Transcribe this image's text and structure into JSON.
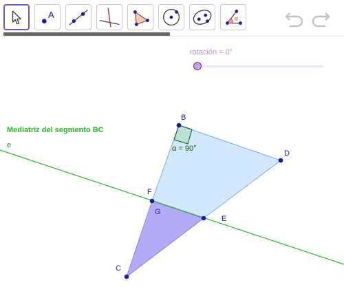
{
  "toolbar": {
    "tools": [
      {
        "name": "move-tool",
        "icon": "arrow-cursor-icon",
        "selected": true
      },
      {
        "name": "point-tool",
        "icon": "point-a-icon",
        "glyph": "A"
      },
      {
        "name": "line-tool",
        "icon": "line-through-points-icon"
      },
      {
        "name": "perpendicular-line-tool",
        "icon": "perpendicular-line-icon"
      },
      {
        "name": "polygon-tool",
        "icon": "polygon-icon"
      },
      {
        "name": "circle-tool",
        "icon": "circle-center-point-icon"
      },
      {
        "name": "conic-tool",
        "icon": "ellipse-icon"
      },
      {
        "name": "angle-tool",
        "icon": "angle-icon",
        "glyph": "α"
      }
    ],
    "undo_icon": "undo-icon",
    "redo_icon": "redo-icon"
  },
  "slider": {
    "label": "rotación = 0°",
    "value": 0
  },
  "labels": {
    "mediatriz": "Mediatriz del segmento BC",
    "line_e": "e",
    "angle": "α = 90°"
  },
  "points": {
    "B": "B",
    "C": "C",
    "D": "D",
    "E": "E",
    "F": "F",
    "G": "G"
  },
  "colors": {
    "accent": "#6557d2",
    "polygon_fill": "#cce6ff",
    "triangle_fill": "#b3abf7",
    "line": "#22bb22",
    "point": "#1a1aa6",
    "slider": "#c9a2ec"
  }
}
